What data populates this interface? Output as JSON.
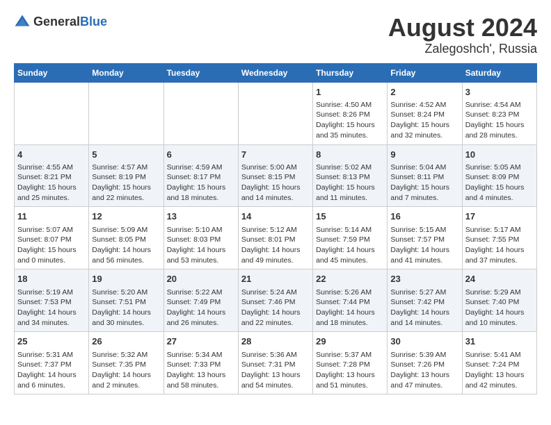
{
  "logo": {
    "general": "General",
    "blue": "Blue"
  },
  "title": "August 2024",
  "subtitle": "Zalegoshch', Russia",
  "days_of_week": [
    "Sunday",
    "Monday",
    "Tuesday",
    "Wednesday",
    "Thursday",
    "Friday",
    "Saturday"
  ],
  "weeks": [
    [
      {
        "day": "",
        "content": ""
      },
      {
        "day": "",
        "content": ""
      },
      {
        "day": "",
        "content": ""
      },
      {
        "day": "",
        "content": ""
      },
      {
        "day": "1",
        "content": "Sunrise: 4:50 AM\nSunset: 8:26 PM\nDaylight: 15 hours\nand 35 minutes."
      },
      {
        "day": "2",
        "content": "Sunrise: 4:52 AM\nSunset: 8:24 PM\nDaylight: 15 hours\nand 32 minutes."
      },
      {
        "day": "3",
        "content": "Sunrise: 4:54 AM\nSunset: 8:23 PM\nDaylight: 15 hours\nand 28 minutes."
      }
    ],
    [
      {
        "day": "4",
        "content": "Sunrise: 4:55 AM\nSunset: 8:21 PM\nDaylight: 15 hours\nand 25 minutes."
      },
      {
        "day": "5",
        "content": "Sunrise: 4:57 AM\nSunset: 8:19 PM\nDaylight: 15 hours\nand 22 minutes."
      },
      {
        "day": "6",
        "content": "Sunrise: 4:59 AM\nSunset: 8:17 PM\nDaylight: 15 hours\nand 18 minutes."
      },
      {
        "day": "7",
        "content": "Sunrise: 5:00 AM\nSunset: 8:15 PM\nDaylight: 15 hours\nand 14 minutes."
      },
      {
        "day": "8",
        "content": "Sunrise: 5:02 AM\nSunset: 8:13 PM\nDaylight: 15 hours\nand 11 minutes."
      },
      {
        "day": "9",
        "content": "Sunrise: 5:04 AM\nSunset: 8:11 PM\nDaylight: 15 hours\nand 7 minutes."
      },
      {
        "day": "10",
        "content": "Sunrise: 5:05 AM\nSunset: 8:09 PM\nDaylight: 15 hours\nand 4 minutes."
      }
    ],
    [
      {
        "day": "11",
        "content": "Sunrise: 5:07 AM\nSunset: 8:07 PM\nDaylight: 15 hours\nand 0 minutes."
      },
      {
        "day": "12",
        "content": "Sunrise: 5:09 AM\nSunset: 8:05 PM\nDaylight: 14 hours\nand 56 minutes."
      },
      {
        "day": "13",
        "content": "Sunrise: 5:10 AM\nSunset: 8:03 PM\nDaylight: 14 hours\nand 53 minutes."
      },
      {
        "day": "14",
        "content": "Sunrise: 5:12 AM\nSunset: 8:01 PM\nDaylight: 14 hours\nand 49 minutes."
      },
      {
        "day": "15",
        "content": "Sunrise: 5:14 AM\nSunset: 7:59 PM\nDaylight: 14 hours\nand 45 minutes."
      },
      {
        "day": "16",
        "content": "Sunrise: 5:15 AM\nSunset: 7:57 PM\nDaylight: 14 hours\nand 41 minutes."
      },
      {
        "day": "17",
        "content": "Sunrise: 5:17 AM\nSunset: 7:55 PM\nDaylight: 14 hours\nand 37 minutes."
      }
    ],
    [
      {
        "day": "18",
        "content": "Sunrise: 5:19 AM\nSunset: 7:53 PM\nDaylight: 14 hours\nand 34 minutes."
      },
      {
        "day": "19",
        "content": "Sunrise: 5:20 AM\nSunset: 7:51 PM\nDaylight: 14 hours\nand 30 minutes."
      },
      {
        "day": "20",
        "content": "Sunrise: 5:22 AM\nSunset: 7:49 PM\nDaylight: 14 hours\nand 26 minutes."
      },
      {
        "day": "21",
        "content": "Sunrise: 5:24 AM\nSunset: 7:46 PM\nDaylight: 14 hours\nand 22 minutes."
      },
      {
        "day": "22",
        "content": "Sunrise: 5:26 AM\nSunset: 7:44 PM\nDaylight: 14 hours\nand 18 minutes."
      },
      {
        "day": "23",
        "content": "Sunrise: 5:27 AM\nSunset: 7:42 PM\nDaylight: 14 hours\nand 14 minutes."
      },
      {
        "day": "24",
        "content": "Sunrise: 5:29 AM\nSunset: 7:40 PM\nDaylight: 14 hours\nand 10 minutes."
      }
    ],
    [
      {
        "day": "25",
        "content": "Sunrise: 5:31 AM\nSunset: 7:37 PM\nDaylight: 14 hours\nand 6 minutes."
      },
      {
        "day": "26",
        "content": "Sunrise: 5:32 AM\nSunset: 7:35 PM\nDaylight: 14 hours\nand 2 minutes."
      },
      {
        "day": "27",
        "content": "Sunrise: 5:34 AM\nSunset: 7:33 PM\nDaylight: 13 hours\nand 58 minutes."
      },
      {
        "day": "28",
        "content": "Sunrise: 5:36 AM\nSunset: 7:31 PM\nDaylight: 13 hours\nand 54 minutes."
      },
      {
        "day": "29",
        "content": "Sunrise: 5:37 AM\nSunset: 7:28 PM\nDaylight: 13 hours\nand 51 minutes."
      },
      {
        "day": "30",
        "content": "Sunrise: 5:39 AM\nSunset: 7:26 PM\nDaylight: 13 hours\nand 47 minutes."
      },
      {
        "day": "31",
        "content": "Sunrise: 5:41 AM\nSunset: 7:24 PM\nDaylight: 13 hours\nand 42 minutes."
      }
    ]
  ]
}
